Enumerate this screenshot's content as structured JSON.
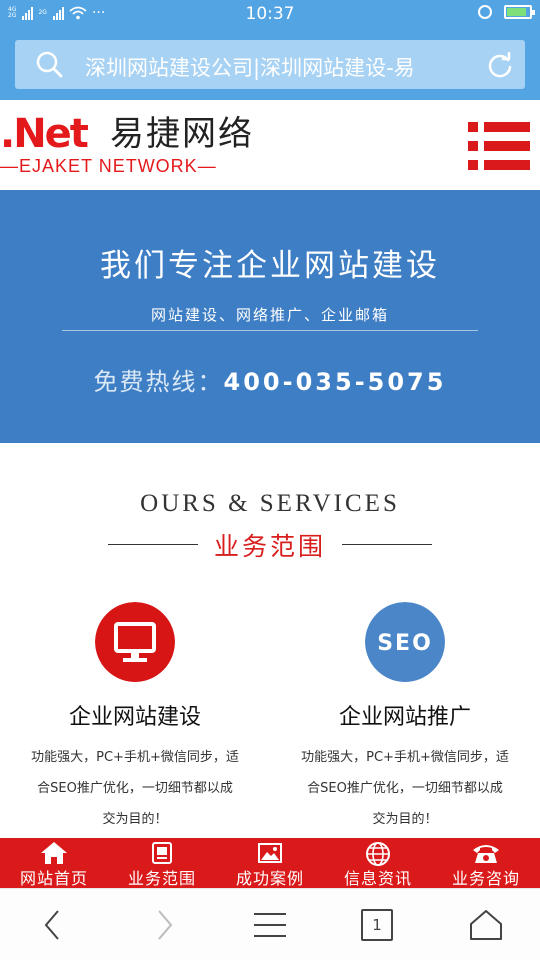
{
  "status_bar": {
    "network_top": "4G",
    "network_bottom": "2G",
    "network2_top": "2G",
    "dots": "···",
    "time": "10:37"
  },
  "address_bar": {
    "page_title": "深圳网站建设公司|深圳网站建设-易"
  },
  "header": {
    "logo_net": ".Net",
    "logo_cn": "易捷网络",
    "logo_en": "—EJAKET NETWORK—"
  },
  "banner": {
    "title": "我们专注企业网站建设",
    "subtitle": "网站建设、网络推广、企业邮箱",
    "hotline_label": "免费热线：",
    "hotline_number": "400-035-5075"
  },
  "services": {
    "heading_en": "OURS & SERVICES",
    "heading_cn": "业务范围",
    "items": [
      {
        "title": "企业网站建设",
        "desc_lines": [
          "功能强大，PC+手机+微信同步，适",
          "合SEO推广优化，一切细节都以成",
          "交为目的！"
        ],
        "icon": "monitor-icon",
        "color": "#d71515"
      },
      {
        "title": "企业网站推广",
        "desc_lines": [
          "功能强大，PC+手机+微信同步，适",
          "合SEO推广优化，一切细节都以成",
          "交为目的！"
        ],
        "icon": "seo-icon",
        "icon_text": "SEO",
        "color": "#4a86c8"
      }
    ]
  },
  "site_nav": {
    "items": [
      {
        "label": "网站首页",
        "icon": "home-icon"
      },
      {
        "label": "业务范围",
        "icon": "document-icon"
      },
      {
        "label": "成功案例",
        "icon": "picture-icon"
      },
      {
        "label": "信息资讯",
        "icon": "globe-icon"
      },
      {
        "label": "业务咨询",
        "icon": "phone-icon"
      }
    ]
  },
  "toolbar": {
    "tab_count": "1"
  },
  "colors": {
    "status_blue": "#53a4e3",
    "brand_red": "#da1a1a",
    "banner_blue": "#3e7ec4"
  }
}
